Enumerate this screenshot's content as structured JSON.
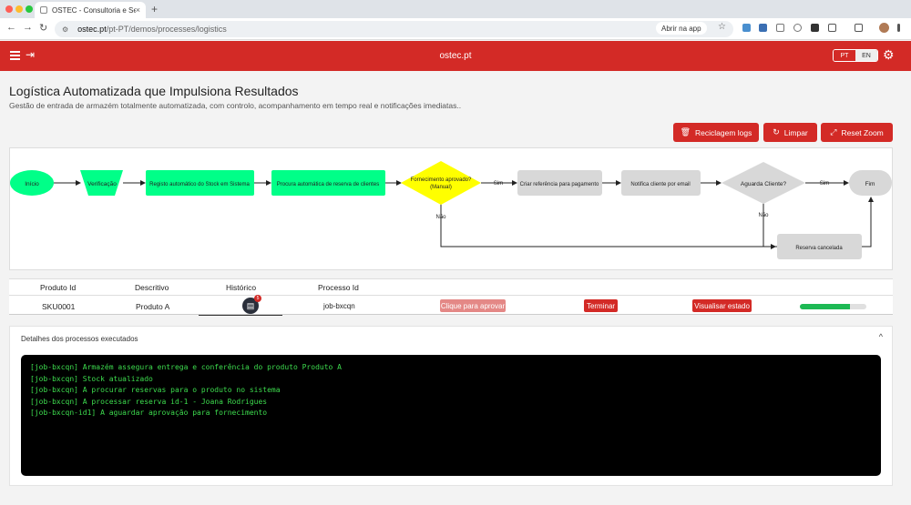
{
  "browser": {
    "tab_title": "OSTEC - Consultoria e Serviç",
    "tab_close": "×",
    "new_tab": "+",
    "url_host": "ostec.pt",
    "url_path": "/pt-PT/demos/processes/logistics",
    "open_app": "Abrir na app",
    "back": "←",
    "forward": "→",
    "reload": "↻",
    "star": "☆"
  },
  "header": {
    "brand": "ostec.pt",
    "lang_pt": "PT",
    "lang_en": "EN",
    "gear": "⚙",
    "login": "⇥"
  },
  "page": {
    "title": "Logística Automatizada que Impulsiona Resultados",
    "subtitle": "Gestão de entrada de armazém totalmente automatizada, com controlo, acompanhamento em tempo real e notificações imediatas.."
  },
  "actions": {
    "recycle_logs": "Reciclagem logs",
    "recycle_icon": "🗑",
    "clear": "Limpar",
    "clear_icon": "↻",
    "reset_zoom": "Reset Zoom",
    "reset_icon": "⤢"
  },
  "flow": {
    "start": "Início",
    "verification": "Verificação",
    "stock_register": "Registo automático do Stock em Sistema",
    "client_reservation": "Procura automática de reserva de clientes",
    "supply_approved_1": "Fornecimento aprovado?",
    "supply_approved_2": "(Manual)",
    "payment_ref": "Criar referência para pagamento",
    "notify_email": "Notifica cliente por email",
    "await_client": "Aguarda Cliente?",
    "end": "Fim",
    "cancelled": "Reserva cancelada",
    "yes_1": "Sim",
    "yes_2": "Sim",
    "no_1": "Não",
    "no_2": "Não"
  },
  "table": {
    "headers": {
      "product_id": "Produto Id",
      "description": "Descritivo",
      "history": "Histórico",
      "process_id": "Processo Id"
    },
    "row": {
      "product_id": "SKU0001",
      "description": "Produto A",
      "history_count": "5",
      "process_id": "job-bxcqn",
      "approve": "Clique para aprovar",
      "finish": "Terminar",
      "view_state": "Visualisar estado",
      "progress": 0.75
    }
  },
  "details": {
    "title": "Detalhes dos processos executados",
    "chevron": "^",
    "log_lines": [
      "[job-bxcqn] Armazém assegura entrega e conferência do produto Produto A",
      "[job-bxcqn] Stock atualizado",
      "[job-bxcqn] A procurar reservas para o produto no sistema",
      "[job-bxcqn] A processar reserva id-1 - Joana Rodrigues",
      "[job-bxcqn-id1] A aguardar aprovação para fornecimento"
    ]
  },
  "colors": {
    "brand_red": "#d32a26",
    "green_node": "#00ff88",
    "yellow_node": "#ffff00",
    "gray_node": "#d8d8d8",
    "terminal_text": "#3ddc4e"
  }
}
